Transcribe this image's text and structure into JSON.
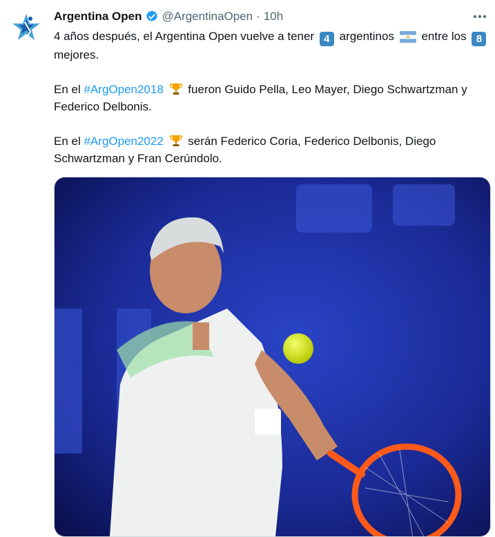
{
  "tweet": {
    "author_name": "Argentina Open",
    "handle": "@ArgentinaOpen",
    "separator": "·",
    "time": "10h",
    "text": {
      "line1_a": "4 años después, el Argentina Open vuelve a tener",
      "num4": "4",
      "line1_b": "argentinos",
      "line1_c": "entre los",
      "num8": "8",
      "line1_d": "mejores.",
      "p2_a": "En el",
      "hashtag1": "#ArgOpen2018",
      "p2_b": "fueron Guido Pella, Leo Mayer, Diego Schwartzman y Federico Delbonis.",
      "p3_a": "En el",
      "hashtag2": "#ArgOpen2022",
      "p3_b": "serán Federico Coria, Federico Delbonis, Diego Schwartzman y Fran Cerúndolo."
    },
    "icons": {
      "avatar": "star-logo-icon",
      "verified": "verified-badge-icon",
      "more": "more-options-icon",
      "flag": "argentina-flag-icon",
      "trophy": "trophy-icon"
    },
    "colors": {
      "link": "#1d9bf0",
      "verified": "#1d9bf0",
      "keycap": "#3b88c3",
      "photo_background": "#1f2f9e"
    }
  }
}
